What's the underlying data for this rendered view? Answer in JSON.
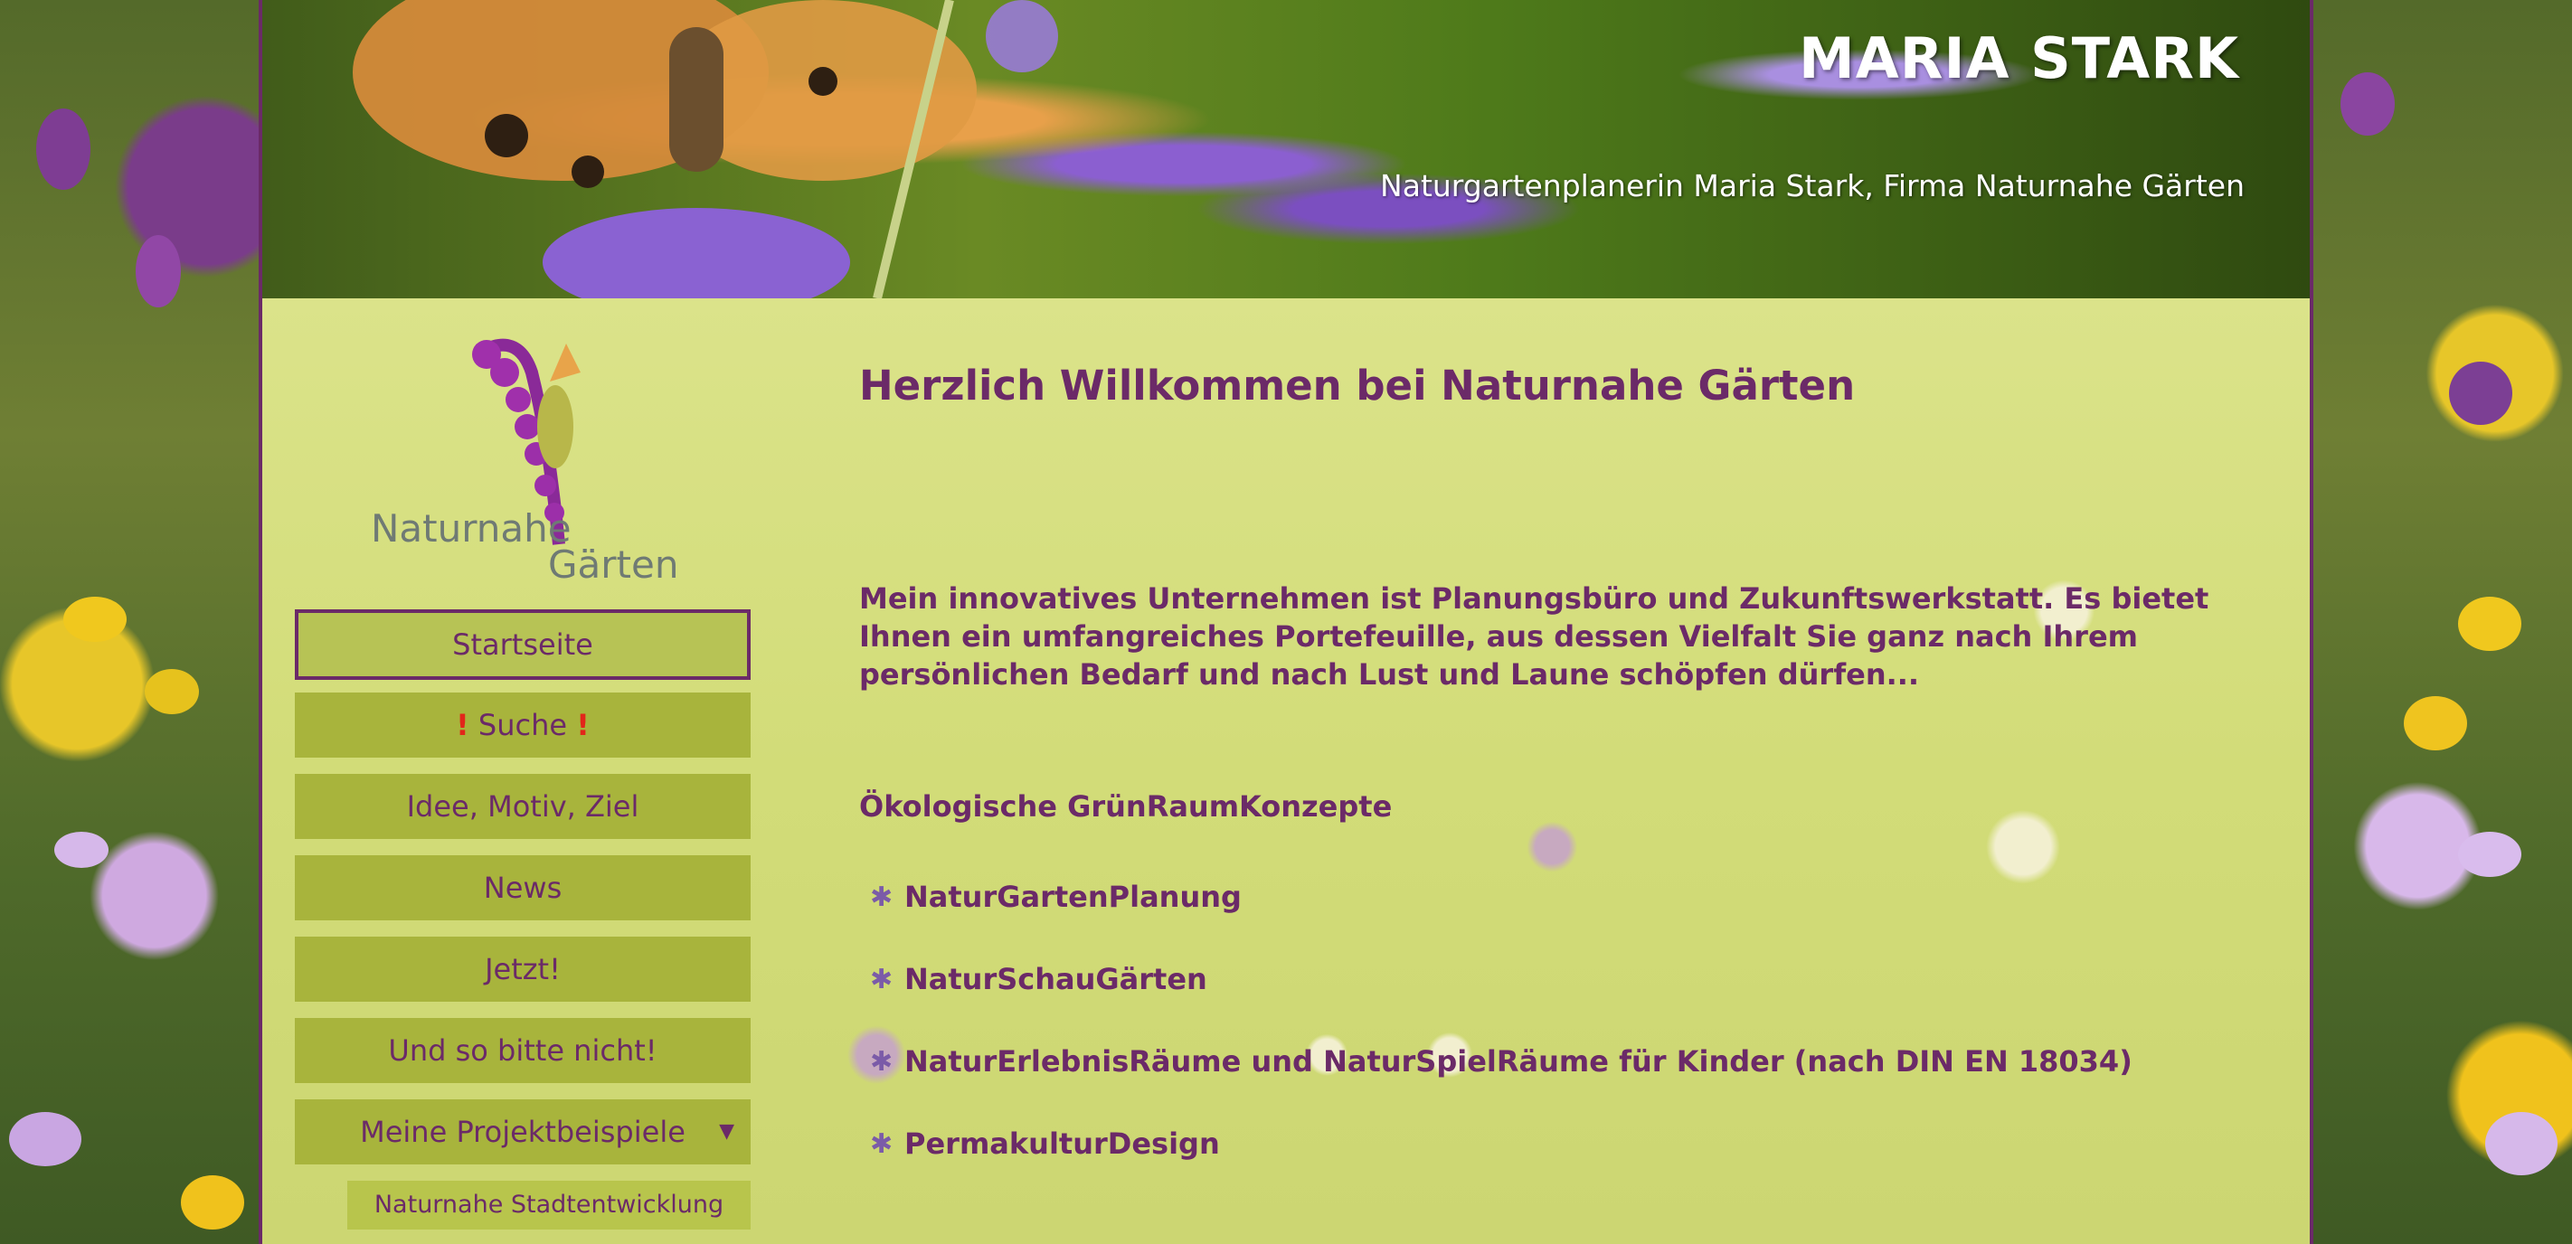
{
  "header": {
    "title": "MARIA STARK",
    "subtitle": "Naturgartenplanerin Maria Stark, Firma Naturnahe Gärten"
  },
  "logo": {
    "line1": "Naturnahe",
    "line2": "Gärten"
  },
  "nav": {
    "items": [
      {
        "label": "Startseite",
        "active": true
      },
      {
        "label": "Suche",
        "prefix": "!",
        "suffix": "!"
      },
      {
        "label": "Idee, Motiv, Ziel"
      },
      {
        "label": "News"
      },
      {
        "label": "Jetzt!"
      },
      {
        "label": "Und so bitte nicht!"
      },
      {
        "label": "Meine Projektbeispiele",
        "has_submenu": true
      }
    ],
    "submenu": [
      {
        "label": "Naturnahe Stadtentwicklung"
      }
    ]
  },
  "content": {
    "heading": "Herzlich Willkommen bei Naturnahe Gärten",
    "intro": "Mein innovatives Unternehmen ist Planungsbüro und Zukunftswerkstatt. Es bietet Ihnen ein umfangreiches Portefeuille, aus dessen Vielfalt Sie ganz nach Ihrem persönlichen Bedarf und nach Lust und Laune schöpfen dürfen...",
    "subheading": "Ökologische GrünRaumKonzepte",
    "list": [
      "NaturGartenPlanung",
      "NaturSchauGärten",
      "NaturErlebnisRäume und NaturSpielRäume für Kinder (nach DIN EN 18034)",
      "PermakulturDesign"
    ]
  },
  "colors": {
    "accent": "#6b2a68",
    "nav_bg": "#a8b43c",
    "alert": "#e2261a"
  },
  "icons": {
    "list_bullet": "purple-flower-icon",
    "submenu_caret": "caret-down-icon"
  }
}
